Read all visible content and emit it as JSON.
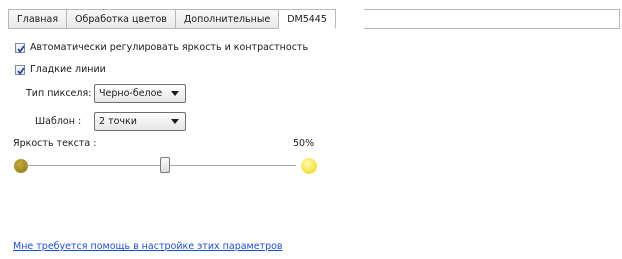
{
  "tabs": [
    {
      "label": "Главная",
      "active": false
    },
    {
      "label": "Обработка цветов",
      "active": false
    },
    {
      "label": "Дополнительные",
      "active": false
    },
    {
      "label": "DM5445",
      "active": true
    }
  ],
  "options": {
    "auto_brightness": {
      "label": "Автоматически регулировать яркость и контрастность",
      "checked": true
    },
    "smooth_lines": {
      "label": "Гладкие линии",
      "checked": true
    }
  },
  "pixel_type": {
    "label": "Тип пикселя:",
    "value": "Черно-белое"
  },
  "template": {
    "label": "Шаблон :",
    "value": "2 точки"
  },
  "text_brightness": {
    "label": "Яркость текста :",
    "value_text": "50%",
    "value": 0.5,
    "dark_color": "#a48f1a",
    "bright_color": "#f0e63c"
  },
  "help_link": "Мне требуется помощь в настройке этих параметров",
  "colors": {
    "accent_link": "#1d4fd1",
    "border": "#b8b8b8"
  }
}
